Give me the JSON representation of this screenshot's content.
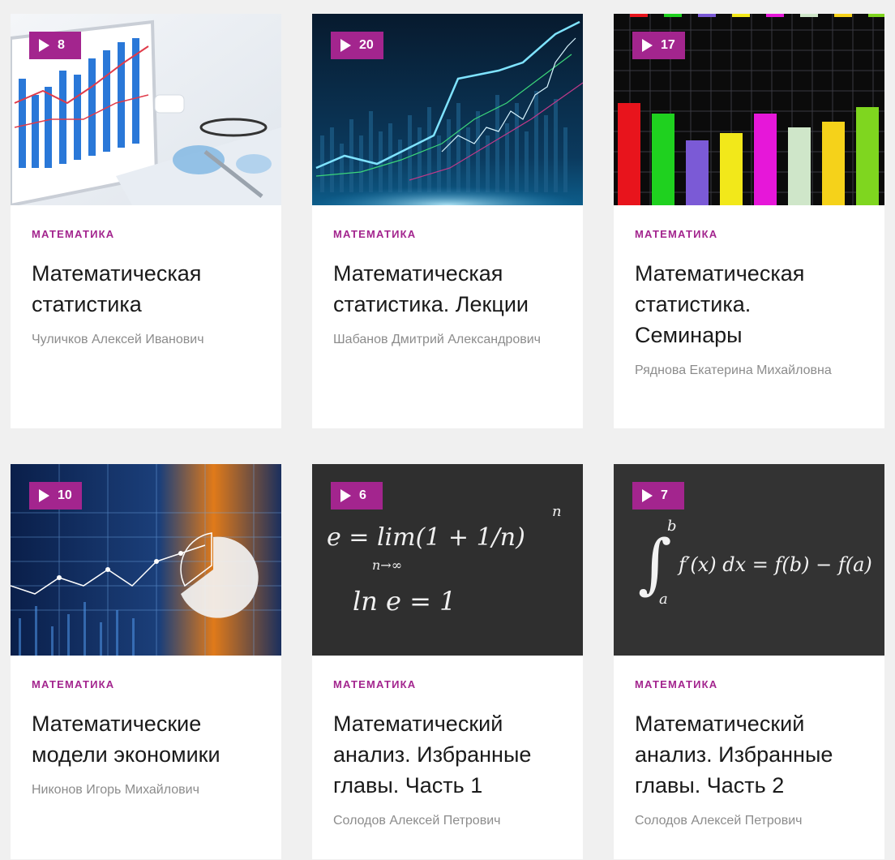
{
  "courses": [
    {
      "count": "8",
      "category": "МАТЕМАТИКА",
      "title": "Математическая статистика",
      "author": "Чуличков Алексей Иванович",
      "thumb": "laptop-charts"
    },
    {
      "count": "20",
      "category": "МАТЕМАТИКА",
      "title": "Математическая статистика. Лекции",
      "author": "Шабанов Дмитрий Александрович",
      "thumb": "stock-chart"
    },
    {
      "count": "17",
      "category": "МАТЕМАТИКА",
      "title": "Математическая статистика. Семинары",
      "author": "Ряднова Екатерина Михайловна",
      "thumb": "bar-chart"
    },
    {
      "count": "10",
      "category": "МАТЕМАТИКА",
      "title": "Математические модели экономики",
      "author": "Никонов Игорь Михайлович",
      "thumb": "abstract-graph"
    },
    {
      "count": "6",
      "category": "МАТЕМАТИКА",
      "title": "Математический анализ. Избранные главы. Часть 1",
      "author": "Солодов Алексей Петрович",
      "thumb": "chalkboard-limit"
    },
    {
      "count": "7",
      "category": "МАТЕМАТИКА",
      "title": "Математический анализ. Избранные главы. Часть 2",
      "author": "Солодов Алексей Петрович",
      "thumb": "chalkboard-integral"
    }
  ],
  "chalk": {
    "limit_line1": "e = lim(1 + 1/n)",
    "limit_sup": "n",
    "limit_sub": "n→∞",
    "limit_line2": "ln e = 1",
    "integral_expr": "f′(x) dx = f(b) − f(a)",
    "integral_upper": "b",
    "integral_lower": "a"
  },
  "colors": {
    "accent": "#a3258e",
    "bars": [
      "#e8141c",
      "#1fd11f",
      "#7b5ad6",
      "#f2e81a",
      "#e617d9",
      "#cfe6c9",
      "#f5d21a",
      "#7fd61f"
    ]
  }
}
